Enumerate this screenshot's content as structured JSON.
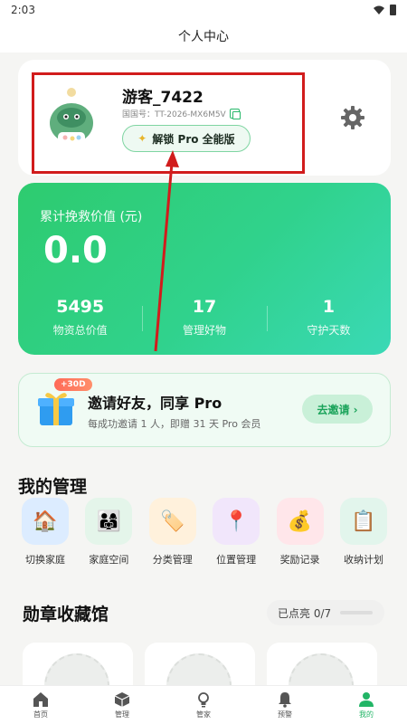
{
  "status": {
    "time": "2:03"
  },
  "header": {
    "title": "个人中心"
  },
  "profile": {
    "name": "游客_7422",
    "id_label": "国国号：TT-2026-MX6M5V",
    "unlock_label": "解锁 Pro 全能版"
  },
  "stats": {
    "title": "累计挽救价值 (元)",
    "value": "0.0",
    "items": [
      {
        "value": "5495",
        "label": "物资总价值"
      },
      {
        "value": "17",
        "label": "管理好物"
      },
      {
        "value": "1",
        "label": "守护天数"
      }
    ]
  },
  "invite": {
    "badge": "+30D",
    "title": "邀请好友，同享 Pro",
    "subtitle": "每成功邀请 1 人，即赠 31 天 Pro 会员",
    "button": "去邀请 ›"
  },
  "management": {
    "title": "我的管理",
    "items": [
      {
        "label": "切换家庭",
        "icon": "house-icon",
        "color": "#dcecff"
      },
      {
        "label": "家庭空间",
        "icon": "family-icon",
        "color": "#e4f5ea"
      },
      {
        "label": "分类管理",
        "icon": "tag-icon",
        "color": "#fff1dc"
      },
      {
        "label": "位置管理",
        "icon": "pin-icon",
        "color": "#f1e6fb"
      },
      {
        "label": "奖励记录",
        "icon": "money-bag-icon",
        "color": "#ffe6ea"
      },
      {
        "label": "收纳计划",
        "icon": "clipboard-icon",
        "color": "#e2f5ec"
      }
    ]
  },
  "medals": {
    "title": "勋章收藏馆",
    "progress": "已点亮 0/7"
  },
  "nav": {
    "items": [
      {
        "label": "首页",
        "icon": "home-icon"
      },
      {
        "label": "管理",
        "icon": "box-icon"
      },
      {
        "label": "管家",
        "icon": "bulb-icon"
      },
      {
        "label": "预警",
        "icon": "bell-icon"
      },
      {
        "label": "我的",
        "icon": "user-icon",
        "active": true
      }
    ]
  },
  "colors": {
    "accent": "#2ecb6f",
    "annotation": "#d11c1c"
  }
}
